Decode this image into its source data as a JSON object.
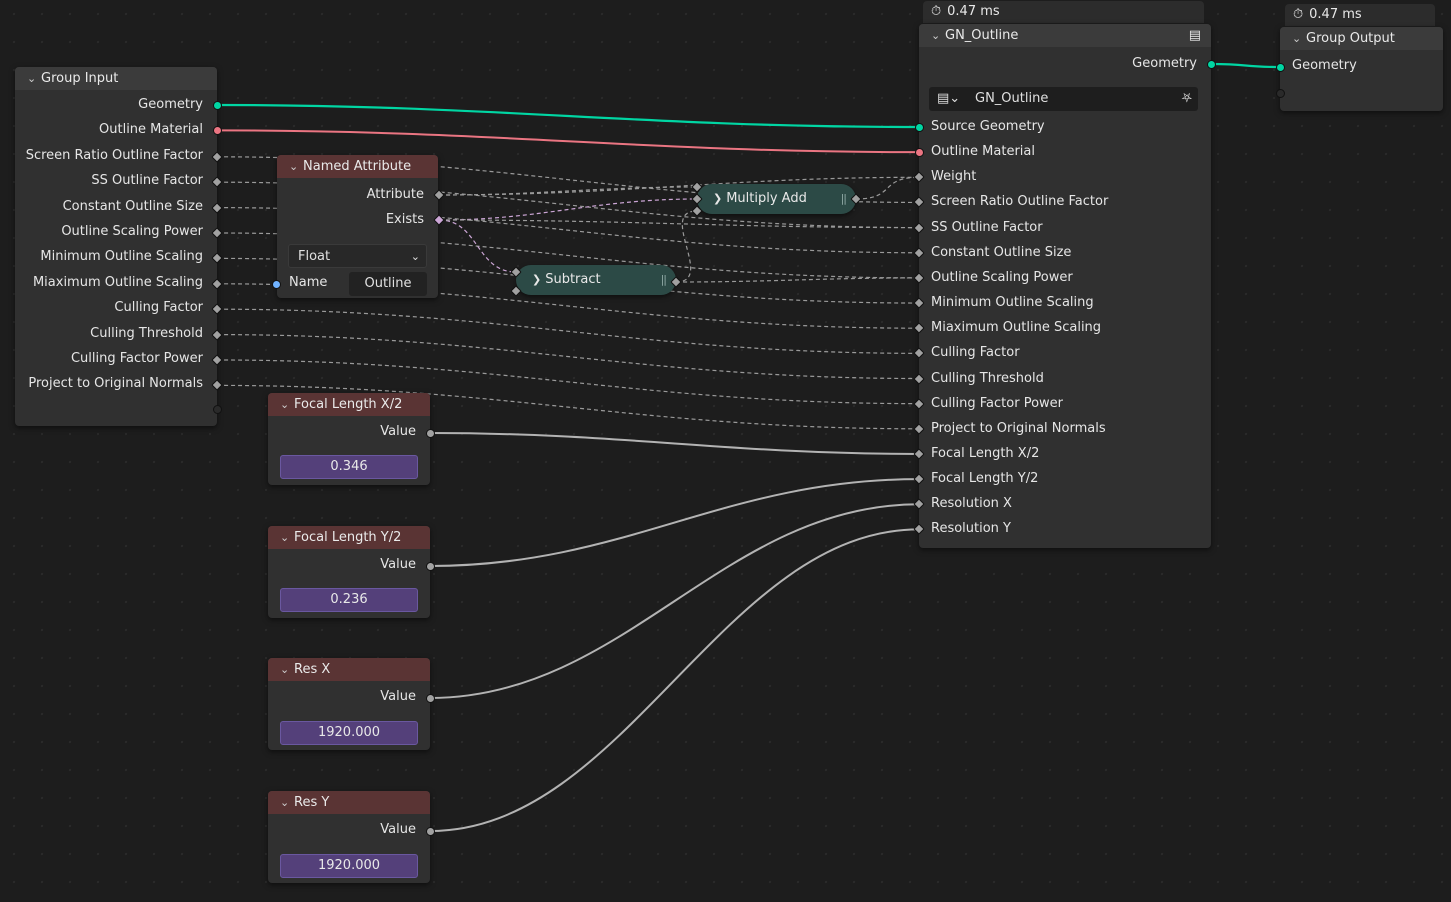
{
  "timers": {
    "gn_outline": "0.47 ms",
    "group_output": "0.47 ms"
  },
  "group_input": {
    "title": "Group Input",
    "outputs": [
      "Geometry",
      "Outline Material",
      "Screen Ratio Outline Factor",
      "SS Outline Factor",
      "Constant Outline Size",
      "Outline Scaling Power",
      "Minimum Outline Scaling",
      "Miaximum Outline Scaling",
      "Culling Factor",
      "Culling Threshold",
      "Culling Factor Power",
      "Project to Original Normals"
    ]
  },
  "named_attribute": {
    "title": "Named Attribute",
    "outputs": [
      "Attribute",
      "Exists"
    ],
    "type_value": "Float",
    "name_label": "Name",
    "name_value": "Outline"
  },
  "multiply_add": {
    "title": "Multiply Add"
  },
  "subtract": {
    "title": "Subtract"
  },
  "value_nodes": [
    {
      "title": "Focal Length X/2",
      "output": "Value",
      "value": "0.346"
    },
    {
      "title": "Focal Length Y/2",
      "output": "Value",
      "value": "0.236"
    },
    {
      "title": "Res X",
      "output": "Value",
      "value": "1920.000"
    },
    {
      "title": "Res Y",
      "output": "Value",
      "value": "1920.000"
    }
  ],
  "gn_outline": {
    "title": "GN_Outline",
    "output": "Geometry",
    "group_name": "GN_Outline",
    "inputs": [
      "Source Geometry",
      "Outline Material",
      "Weight",
      "Screen Ratio Outline Factor",
      "SS Outline Factor",
      "Constant Outline Size",
      "Outline Scaling Power",
      "Minimum Outline Scaling",
      "Miaximum Outline Scaling",
      "Culling Factor",
      "Culling Threshold",
      "Culling Factor Power",
      "Project to Original Normals",
      "Focal Length X/2",
      "Focal Length Y/2",
      "Resolution X",
      "Resolution Y"
    ]
  },
  "group_output": {
    "title": "Group Output",
    "inputs": [
      "Geometry"
    ]
  },
  "colors": {
    "geometry": "#00d6a3",
    "material": "#eb7582",
    "float_socket": "#a1a1a1",
    "bool_socket": "#cca6d6",
    "string_socket": "#70b2ff",
    "value_field": "#54407a"
  }
}
